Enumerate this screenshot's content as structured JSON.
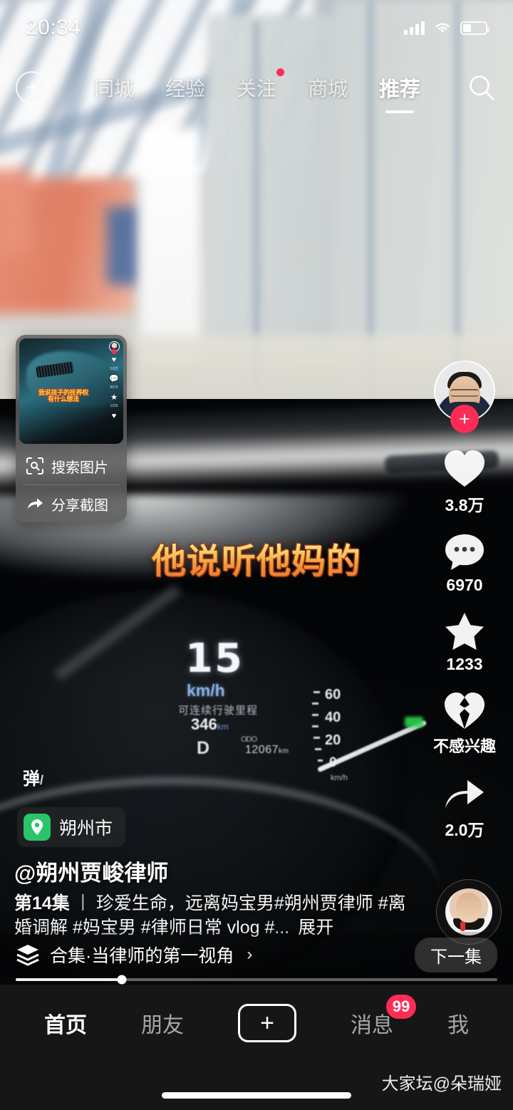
{
  "status_bar": {
    "time": "20:34",
    "battery_level_pct": 36
  },
  "top_nav": {
    "add_icon": "plus-circle-icon",
    "search_icon": "search-icon",
    "tabs": [
      {
        "label": "同城",
        "active": false,
        "badge_dot": false
      },
      {
        "label": "经验",
        "active": false,
        "badge_dot": false
      },
      {
        "label": "关注",
        "active": false,
        "badge_dot": true
      },
      {
        "label": "商城",
        "active": false,
        "badge_dot": false
      },
      {
        "label": "推荐",
        "active": true,
        "badge_dot": false
      }
    ]
  },
  "screenshot_popup": {
    "thumbnail_subtitle_line1": "我说孩子的抚养权",
    "thumbnail_subtitle_line2": "有什么想法",
    "thumb_like": "3.8万",
    "thumb_comment": "6970",
    "thumb_star": "1233",
    "items": [
      {
        "label": "搜索图片",
        "icon": "image-search-icon"
      },
      {
        "label": "分享截图",
        "icon": "share-arrow-icon"
      }
    ]
  },
  "video": {
    "subtitle": "他说听他妈的",
    "dashboard": {
      "speed": "15",
      "speed_unit": "km/h",
      "range_label": "可连续行驶里程",
      "range_value": "346",
      "range_unit": "km",
      "gear": "D",
      "odometer": "12067",
      "odometer_unit": "km",
      "gauge_ticks": [
        "60",
        "40",
        "20",
        "0"
      ],
      "gauge_unit": "km/h"
    }
  },
  "action_rail": {
    "follow_icon": "plus-follow-icon",
    "items": [
      {
        "icon": "heart-icon",
        "label": "3.8万",
        "name": "like"
      },
      {
        "icon": "comment-icon",
        "label": "6970",
        "name": "comment"
      },
      {
        "icon": "star-icon",
        "label": "1233",
        "name": "favorite"
      },
      {
        "icon": "broken-heart-icon",
        "label": "不感兴趣",
        "name": "not-interested"
      },
      {
        "icon": "share-arrow-icon",
        "label": "2.0万",
        "name": "share"
      }
    ]
  },
  "overlay_info": {
    "danmaku_toggle": "弹",
    "location": "朔州市",
    "location_icon": "map-pin-icon",
    "author": "@朔州贾峻律师",
    "caption_episode": "第14集",
    "caption_divider": "丨",
    "caption_text": "珍爱生命，远离妈宝男#朔州贾律师",
    "caption_line2": "#离婚调解 #妈宝男 #律师日常 vlog #...",
    "caption_expand": "展开"
  },
  "collection_bar": {
    "icon": "stack-layers-icon",
    "label": "合集·当律师的第一视角",
    "chevron": "›",
    "next_button": "下一集"
  },
  "progress": {
    "percent": 22
  },
  "bottom_nav": {
    "items": [
      {
        "label": "首页",
        "active": true,
        "badge": null,
        "type": "text"
      },
      {
        "label": "朋友",
        "active": false,
        "badge": null,
        "type": "text"
      },
      {
        "label": "+",
        "active": false,
        "badge": null,
        "type": "plus"
      },
      {
        "label": "消息",
        "active": false,
        "badge": "99",
        "type": "text"
      },
      {
        "label": "我",
        "active": false,
        "badge": null,
        "type": "text"
      }
    ]
  },
  "watermark": "大家坛@朵瑞娅",
  "colors": {
    "accent_red": "#fe2c55",
    "location_green": "#2bc46a",
    "nav_bg": "#161616",
    "subtitle_gold": "#f8d36a",
    "subtitle_orange": "#e8702a"
  }
}
